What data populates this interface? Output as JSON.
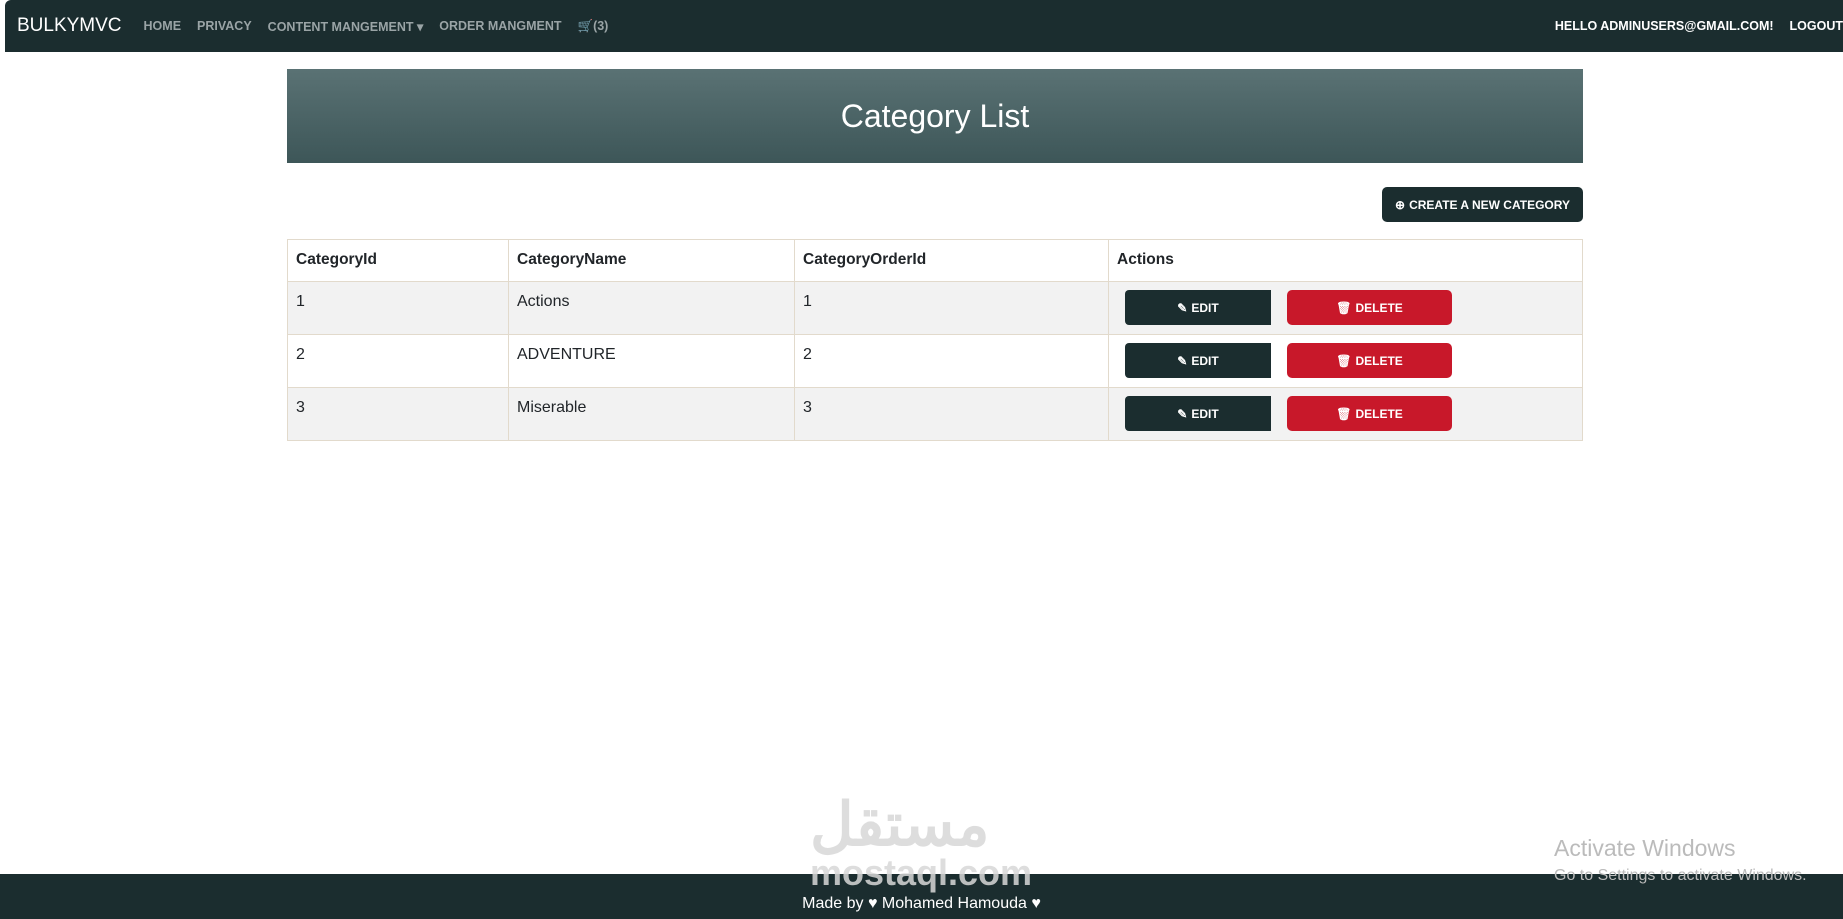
{
  "nav": {
    "brand": "BULKYMVC",
    "items": [
      "HOME",
      "PRIVACY",
      "CONTENT MANGEMENT",
      "ORDER MANGMENT"
    ],
    "cart": "(3)",
    "hello": "HELLO ADMINUSERS@GMAIL.COM!",
    "logout": "LOGOUT"
  },
  "page": {
    "title": "Category List",
    "create_label": "CREATE A NEW CATEGORY"
  },
  "table": {
    "headers": [
      "CategoryId",
      "CategoryName",
      "CategoryOrderId",
      "Actions"
    ],
    "rows": [
      {
        "id": "1",
        "name": "Actions",
        "order": "1"
      },
      {
        "id": "2",
        "name": "ADVENTURE",
        "order": "2"
      },
      {
        "id": "3",
        "name": "Miserable",
        "order": "3"
      }
    ],
    "edit_label": "EDIT",
    "delete_label": "DELETE"
  },
  "footer": {
    "prefix": "Made by",
    "author": "Mohamed Hamouda"
  },
  "watermark": {
    "arabic": "مستقل",
    "latin": "mostaql.com"
  },
  "os": {
    "activate": "Activate Windows",
    "activate_hint": "Go to Settings to activate Windows."
  }
}
